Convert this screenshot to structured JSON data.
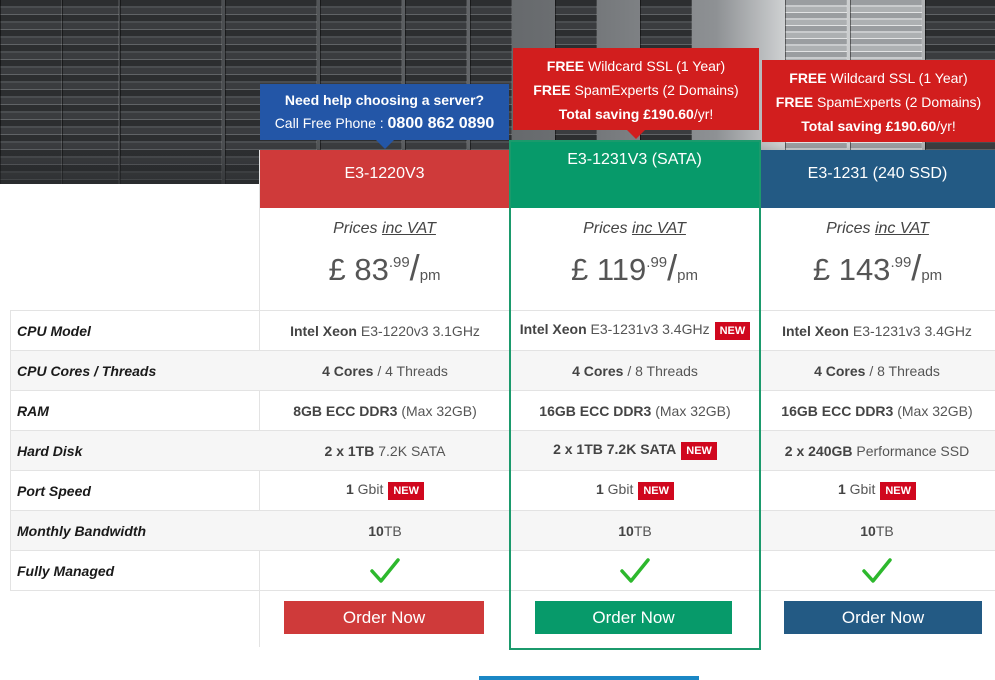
{
  "promos": {
    "help": {
      "title": "Need help choosing a server?",
      "phone_label": "Call Free Phone :",
      "phone": "0800 862 0890"
    },
    "offer_1": {
      "free": "FREE",
      "ssl": "Wildcard SSL (1 Year)",
      "spam": "SpamExperts (2 Domains)",
      "saving_label": "Total saving",
      "saving_value": "£190.60",
      "saving_suffix": "/yr!"
    },
    "offer_2": {
      "free": "FREE",
      "ssl": "Wildcard SSL (1 Year)",
      "spam": "SpamExperts (2 Domains)",
      "saving_label": "Total saving",
      "saving_value": "£190.60",
      "saving_suffix": "/yr!"
    }
  },
  "plans": [
    {
      "name": "E3-1220V3",
      "vat_prefix": "Prices",
      "vat_link": "inc VAT",
      "currency": "£",
      "price_main": "83",
      "price_cents": ".99",
      "per": "/",
      "period": "pm",
      "cpu_bold": "Intel Xeon",
      "cpu_rest": "E3-1220v3 3.1GHz",
      "cores_bold": "4 Cores",
      "cores_rest": "/ 4 Threads",
      "ram_bold": "8GB ECC DDR3",
      "ram_rest": "(Max 32GB)",
      "disk_bold": "2 x 1TB",
      "disk_rest": "7.2K SATA",
      "port_bold": "1",
      "port_rest": "Gbit",
      "bw_bold": "10",
      "bw_rest": "TB",
      "order": "Order Now"
    },
    {
      "name": "E3-1231V3 (SATA)",
      "vat_prefix": "Prices",
      "vat_link": "inc VAT",
      "currency": "£",
      "price_main": "119",
      "price_cents": ".99",
      "per": "/",
      "period": "pm",
      "cpu_bold": "Intel Xeon",
      "cpu_rest": "E3-1231v3 3.4GHz",
      "cores_bold": "4 Cores",
      "cores_rest": "/ 8 Threads",
      "ram_bold": "16GB ECC DDR3",
      "ram_rest": "(Max 32GB)",
      "disk_bold": "2 x 1TB 7.2K SATA",
      "disk_rest": "",
      "port_bold": "1",
      "port_rest": "Gbit",
      "bw_bold": "10",
      "bw_rest": "TB",
      "order": "Order Now"
    },
    {
      "name": "E3-1231 (240 SSD)",
      "vat_prefix": "Prices",
      "vat_link": "inc VAT",
      "currency": "£",
      "price_main": "143",
      "price_cents": ".99",
      "per": "/",
      "period": "pm",
      "cpu_bold": "Intel Xeon",
      "cpu_rest": "E3-1231v3 3.4GHz",
      "cores_bold": "4 Cores",
      "cores_rest": "/ 8 Threads",
      "ram_bold": "16GB ECC DDR3",
      "ram_rest": "(Max 32GB)",
      "disk_bold": "2 x 240GB",
      "disk_rest": "Performance SSD",
      "port_bold": "1",
      "port_rest": "Gbit",
      "bw_bold": "10",
      "bw_rest": "TB",
      "order": "Order Now"
    }
  ],
  "badge_new": "NEW",
  "rows": {
    "cpu": "CPU Model",
    "cores": "CPU Cores / Threads",
    "ram": "RAM",
    "disk": "Hard Disk",
    "port": "Port Speed",
    "bw": "Monthly Bandwidth",
    "managed": "Fully Managed"
  },
  "colors": {
    "red": "#cf3a3a",
    "green": "#079a6a",
    "blue": "#235a84",
    "promo_red": "#d21e1e",
    "promo_blue": "#2356a7",
    "badge": "#d0071e",
    "tick": "#2db82d"
  },
  "icons": {
    "managed": "checkmark-icon"
  }
}
